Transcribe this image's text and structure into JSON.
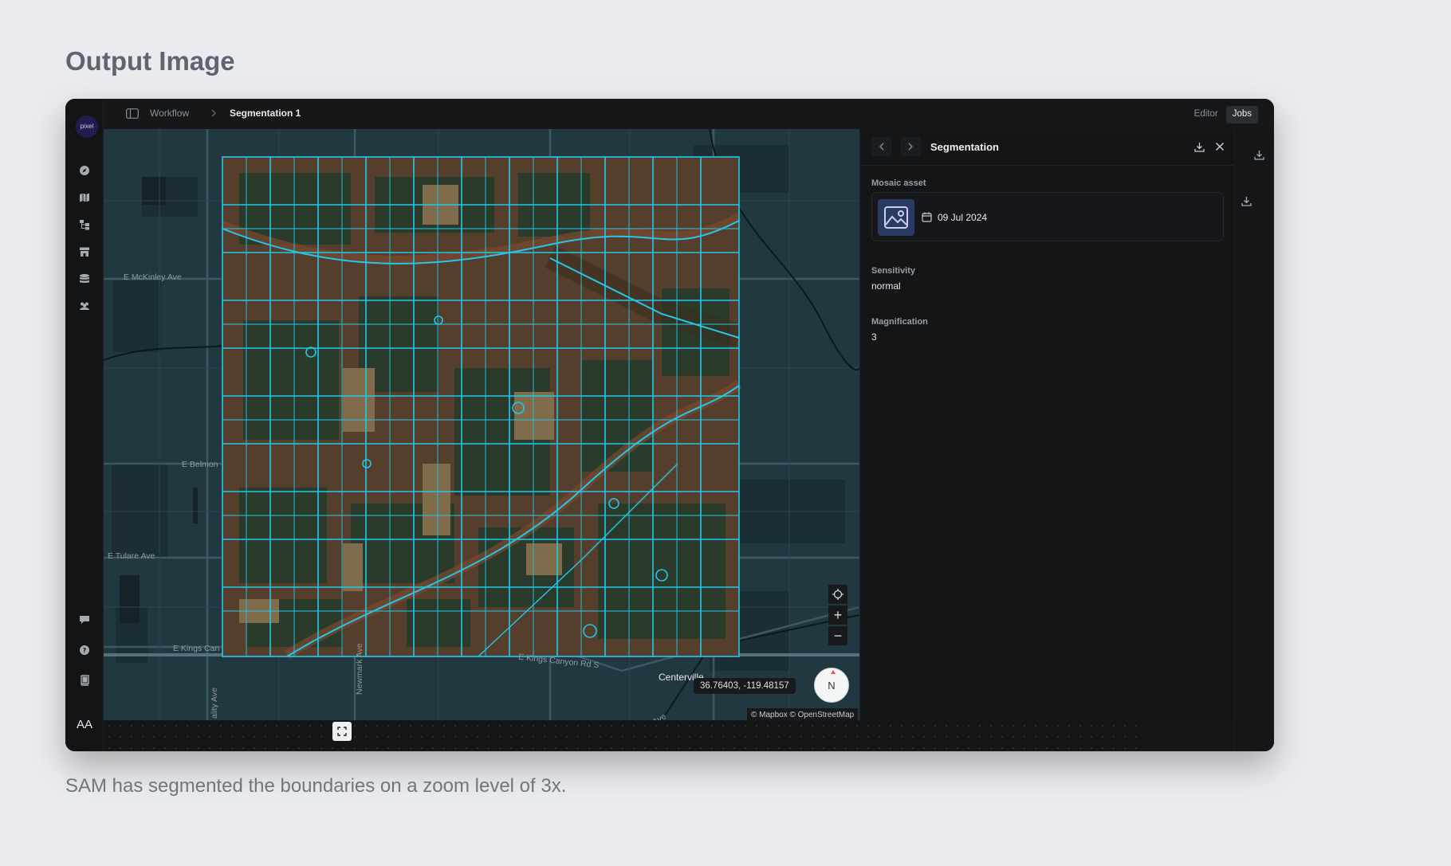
{
  "heading": "Output Image",
  "caption": "SAM has segmented the boundaries on a zoom level of 3x.",
  "app": {
    "logo_text": "pixel",
    "avatar_initials": "AA",
    "breadcrumb": {
      "parent": "Workflow",
      "current": "Segmentation 1"
    },
    "mode_tabs": [
      {
        "label": "Editor",
        "active": false
      },
      {
        "label": "Jobs",
        "active": true
      }
    ],
    "rail_icons": [
      "compass-icon",
      "map-icon",
      "workflow-icon",
      "store-icon",
      "database-icon",
      "team-icon"
    ],
    "rail_bottom_icons": [
      "feedback-icon",
      "help-icon",
      "docs-icon"
    ]
  },
  "map": {
    "road_labels": [
      "E McKinley Ave",
      "E Belmon",
      "E Tulare Ave",
      "E Kings Can",
      "E Kings Canyon Rd S",
      "Newmark Ave",
      "ality Ave",
      "Ave"
    ],
    "place_label": "Centerville",
    "coordinates": "36.76403, -119.48157",
    "compass_label": "N",
    "attribution": "© Mapbox © OpenStreetMap",
    "zoom_in": "+",
    "zoom_out": "−",
    "segment_color": "#22c8ea"
  },
  "panel": {
    "title": "Segmentation",
    "mosaic_label": "Mosaic asset",
    "mosaic_date": "09 Jul 2024",
    "sensitivity_label": "Sensitivity",
    "sensitivity_value": "normal",
    "magnification_label": "Magnification",
    "magnification_value": "3"
  }
}
